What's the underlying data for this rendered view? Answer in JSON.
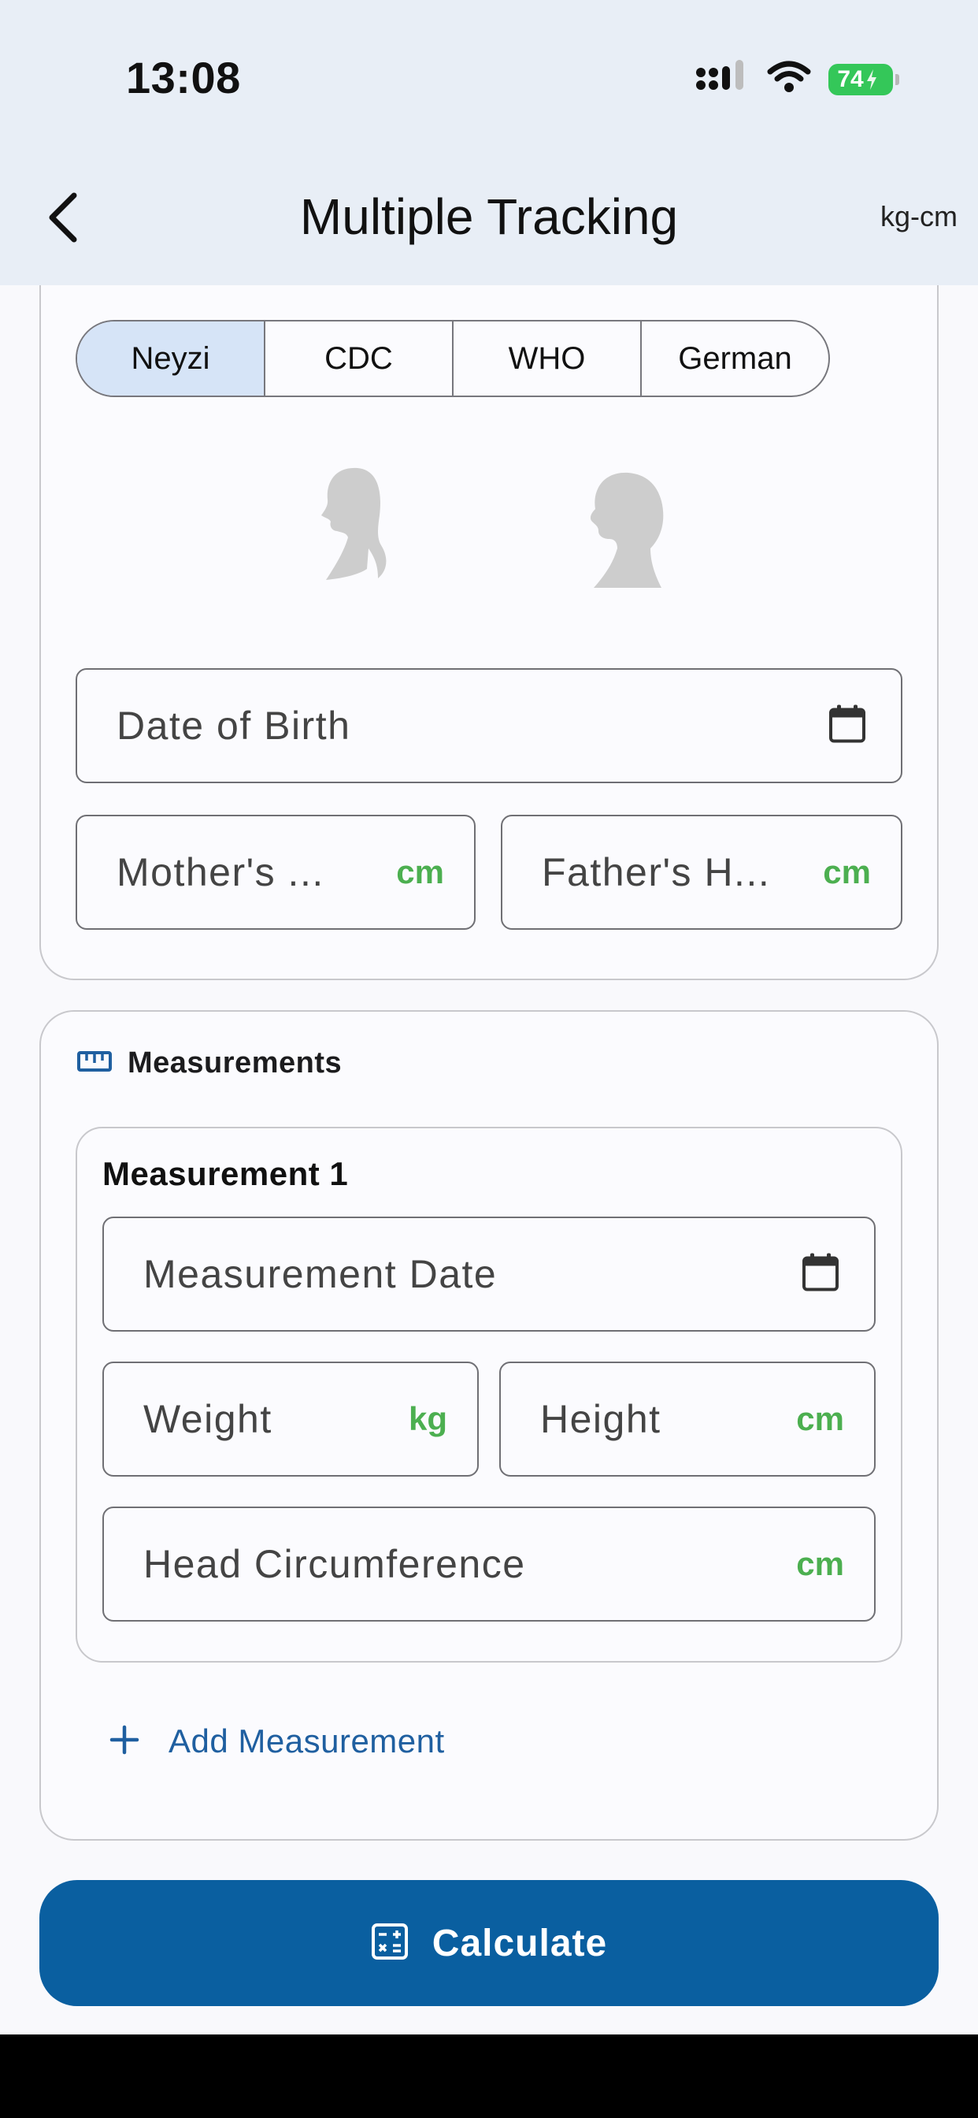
{
  "status_bar": {
    "time": "13:08",
    "battery": "74"
  },
  "header": {
    "title": "Multiple Tracking",
    "unit_toggle": "kg-cm"
  },
  "reference_tabs": [
    {
      "label": "Neyzi",
      "selected": true
    },
    {
      "label": "CDC",
      "selected": false
    },
    {
      "label": "WHO",
      "selected": false
    },
    {
      "label": "German",
      "selected": false
    }
  ],
  "gender": {
    "options": [
      "girl-silhouette-icon",
      "boy-silhouette-icon"
    ]
  },
  "fields": {
    "dob": {
      "label": "Date of Birth"
    },
    "mother_height": {
      "label": "Mother's ...",
      "suffix": "cm"
    },
    "father_height": {
      "label": "Father's H...",
      "suffix": "cm"
    }
  },
  "measurements": {
    "section_title": "Measurements",
    "items": [
      {
        "title": "Measurement 1",
        "date_label": "Measurement Date",
        "weight_label": "Weight",
        "weight_suffix": "kg",
        "height_label": "Height",
        "height_suffix": "cm",
        "head_label": "Head Circumference",
        "head_suffix": "cm"
      }
    ],
    "add_label": "Add Measurement"
  },
  "calculate_label": "Calculate",
  "colors": {
    "accent": "#0a5fa0",
    "unit_green": "#4caf50",
    "selected_tab": "#d6e4f7",
    "header_bg": "#e8eef6"
  }
}
